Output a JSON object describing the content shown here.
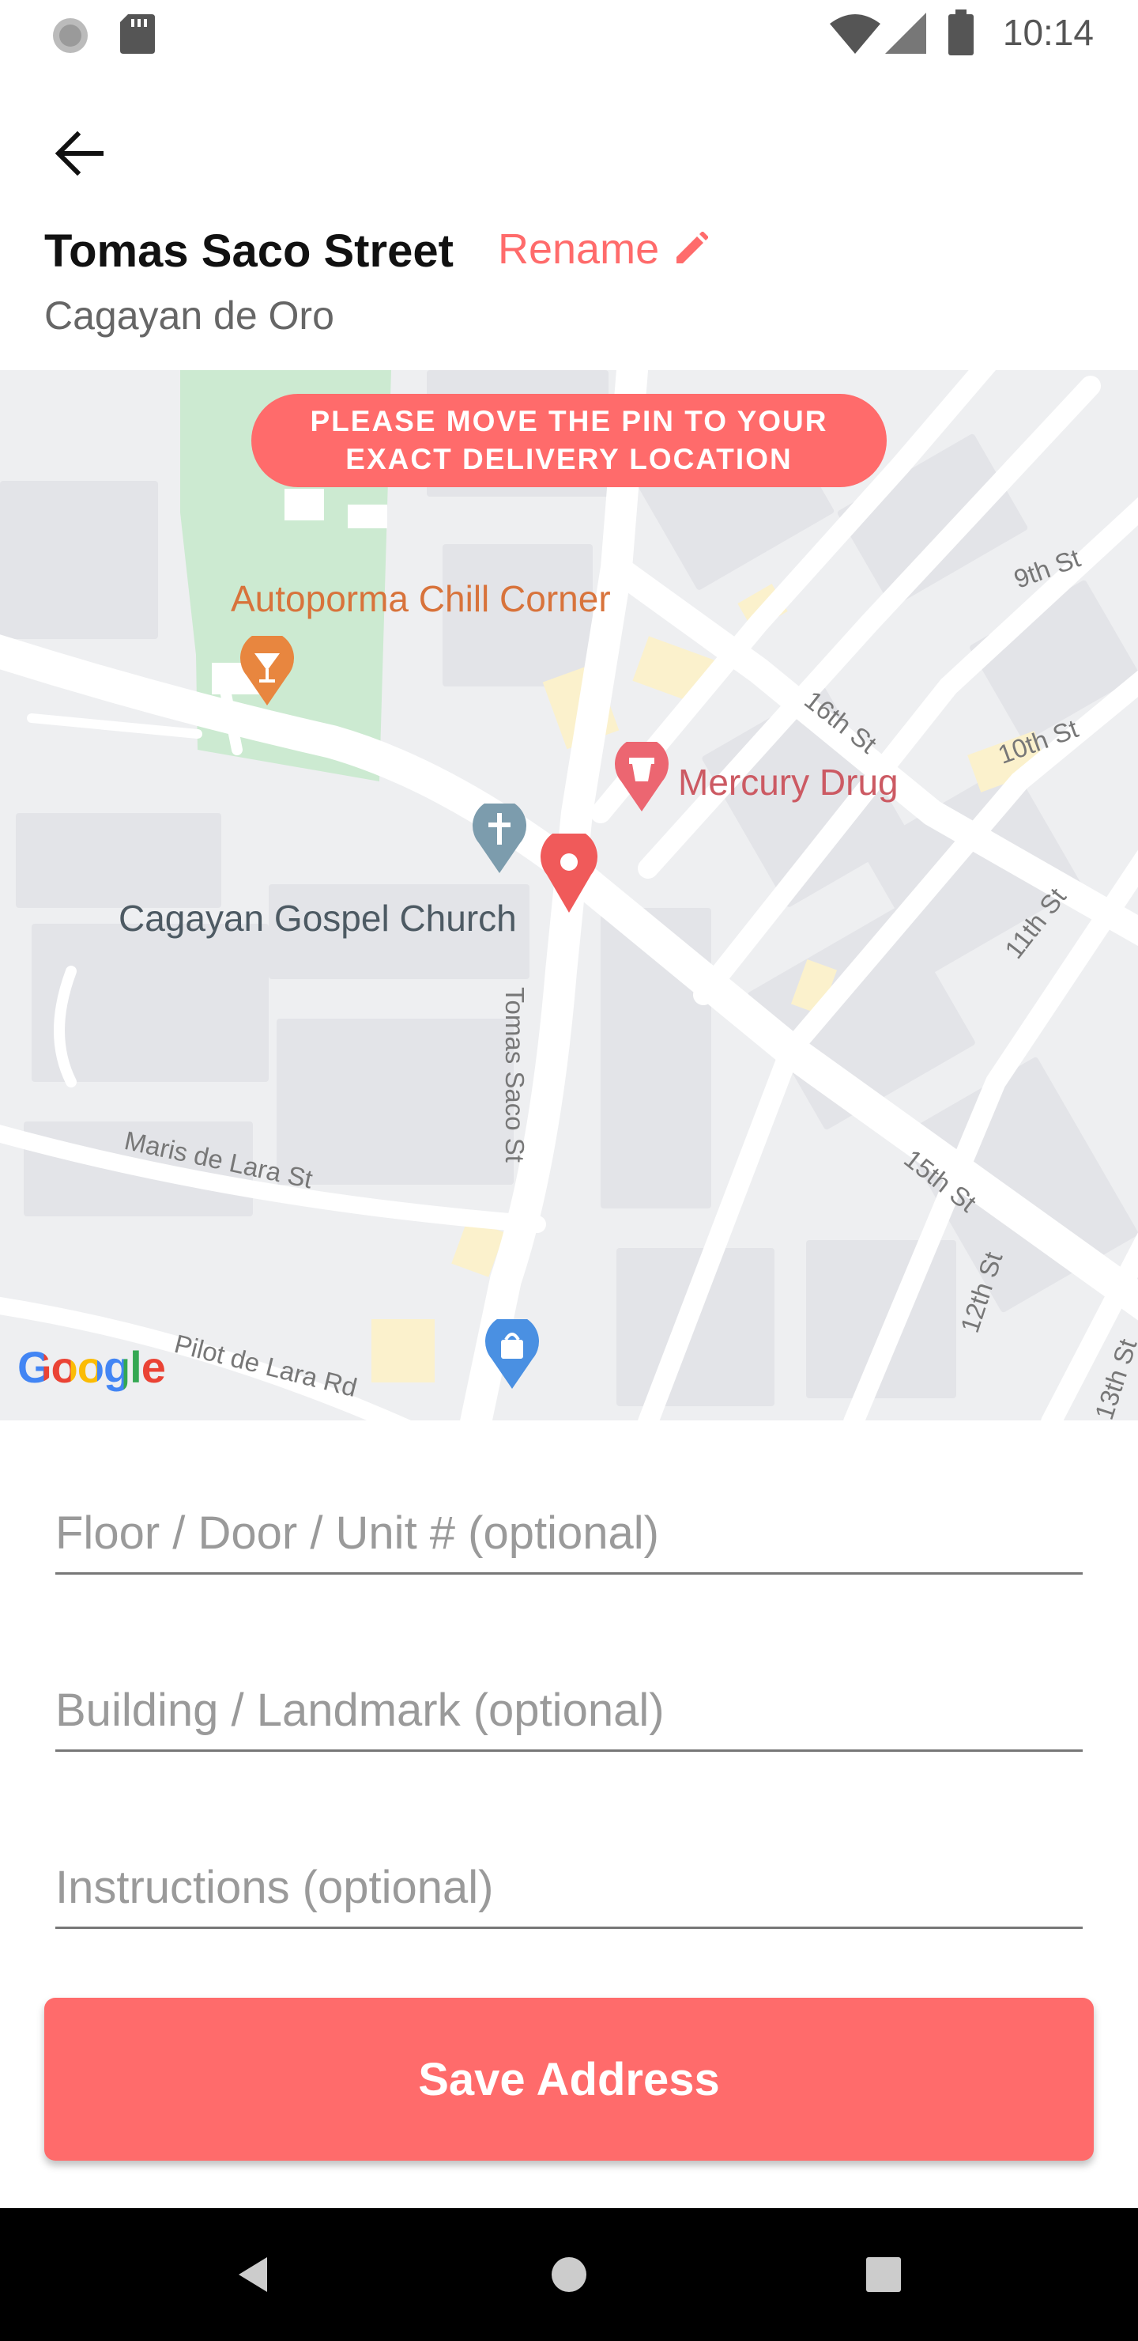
{
  "status_bar": {
    "time": "10:14",
    "left_icons": [
      "loading-icon",
      "sd-card-icon"
    ],
    "right_icons": [
      "wifi-icon",
      "signal-icon",
      "battery-icon"
    ]
  },
  "header": {
    "back_icon": "arrow-left-icon",
    "title": "Tomas Saco Street",
    "rename_label": "Rename",
    "rename_icon": "pencil-icon",
    "subtitle": "Cagayan de Oro"
  },
  "map": {
    "banner_line1": "PLEASE MOVE THE PIN TO YOUR",
    "banner_line2": "EXACT DELIVERY LOCATION",
    "pois": {
      "autoporma": "Autoporma Chill Corner",
      "mercury": "Mercury Drug",
      "church": "Cagayan Gospel Church"
    },
    "streets": {
      "tomas_saco": "Tomas Saco St",
      "maris": "Maris de Lara St",
      "pilot": "Pilot de Lara Rd",
      "s9": "9th St",
      "s10": "10th St",
      "s11": "11th St",
      "s12": "12th St",
      "s13": "13th St",
      "s15": "15th St",
      "s16": "16th St"
    },
    "attribution": "Google",
    "pin_color": "#f05a5a"
  },
  "form": {
    "floor_placeholder": "Floor / Door / Unit # (optional)",
    "building_placeholder": "Building / Landmark (optional)",
    "instructions_placeholder": "Instructions (optional)"
  },
  "save_button": {
    "label": "Save Address",
    "color": "#ff6b6b"
  },
  "nav_bar": {
    "icons": [
      "back-triangle-icon",
      "home-circle-icon",
      "recents-square-icon"
    ]
  }
}
